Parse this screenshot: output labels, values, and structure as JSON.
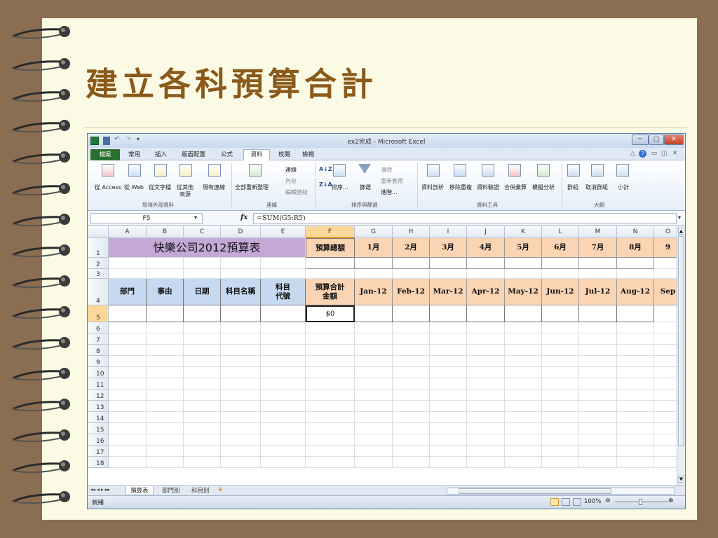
{
  "slide": {
    "title": "建立各科預算合計"
  },
  "window": {
    "title": "ex2完成 - Microsoft Excel"
  },
  "ribbon": {
    "tabs": [
      "檔案",
      "常用",
      "插入",
      "版面配置",
      "公式",
      "資料",
      "校閱",
      "檢視"
    ],
    "active_tab": "資料",
    "buttons": {
      "from_access": "從 Access",
      "from_web": "從 Web",
      "from_text": "從文字檔",
      "from_other_1": "從其他",
      "from_other_2": "來源",
      "existing_conn": "現有連線",
      "refresh_all": "全部重新整理",
      "connections": "連線",
      "properties": "內容",
      "edit_links": "編輯連結",
      "sort_az": "A↓Z",
      "sort": "排序...",
      "filter": "篩選",
      "clear": "清除",
      "reapply": "重新套用",
      "advanced": "進階...",
      "text_to_columns": "資料剖析",
      "remove_dups": "移除重複",
      "validation": "資料驗證",
      "consolidate": "合併彙算",
      "what_if": "模擬分析",
      "group": "群組",
      "ungroup": "取消群組",
      "subtotal": "小計"
    },
    "groups": {
      "get_external": "取得外部資料",
      "connections": "連線",
      "sort_filter": "排序與篩選",
      "data_tools": "資料工具",
      "outline": "大綱"
    }
  },
  "formula_bar": {
    "name_box": "F5",
    "fx": "fx",
    "formula": "=SUM(G5:R5)"
  },
  "columns": [
    "A",
    "B",
    "C",
    "D",
    "E",
    "F",
    "G",
    "H",
    "I",
    "J",
    "K",
    "L",
    "M",
    "N",
    "O"
  ],
  "rows": [
    "1",
    "2",
    "3",
    "4",
    "5",
    "6",
    "7",
    "8",
    "9",
    "10",
    "11",
    "12",
    "13",
    "14",
    "15",
    "16",
    "17",
    "18"
  ],
  "sheet": {
    "banner": "快樂公司2012預算表",
    "budget_total": "預算總額",
    "months": [
      "1月",
      "2月",
      "3月",
      "4月",
      "5月",
      "6月",
      "7月",
      "8月",
      "9"
    ],
    "headers": [
      "部門",
      "事由",
      "日期",
      "科目名稱",
      "科目\n代號",
      "預算合計\n金額"
    ],
    "month_headers": [
      "Jan-12",
      "Feb-12",
      "Mar-12",
      "Apr-12",
      "May-12",
      "Jun-12",
      "Jul-12",
      "Aug-12",
      "Sep"
    ],
    "f5_value": "$0"
  },
  "sheet_tabs": [
    "預算表",
    "部門別",
    "科目別"
  ],
  "status": {
    "ready": "就緒",
    "zoom": "100%"
  },
  "colors": {
    "banner": "#c4a9d6",
    "month_fill": "#fbd4b4",
    "selected": "#fbd4b4",
    "accent": "#2a6f2f"
  }
}
